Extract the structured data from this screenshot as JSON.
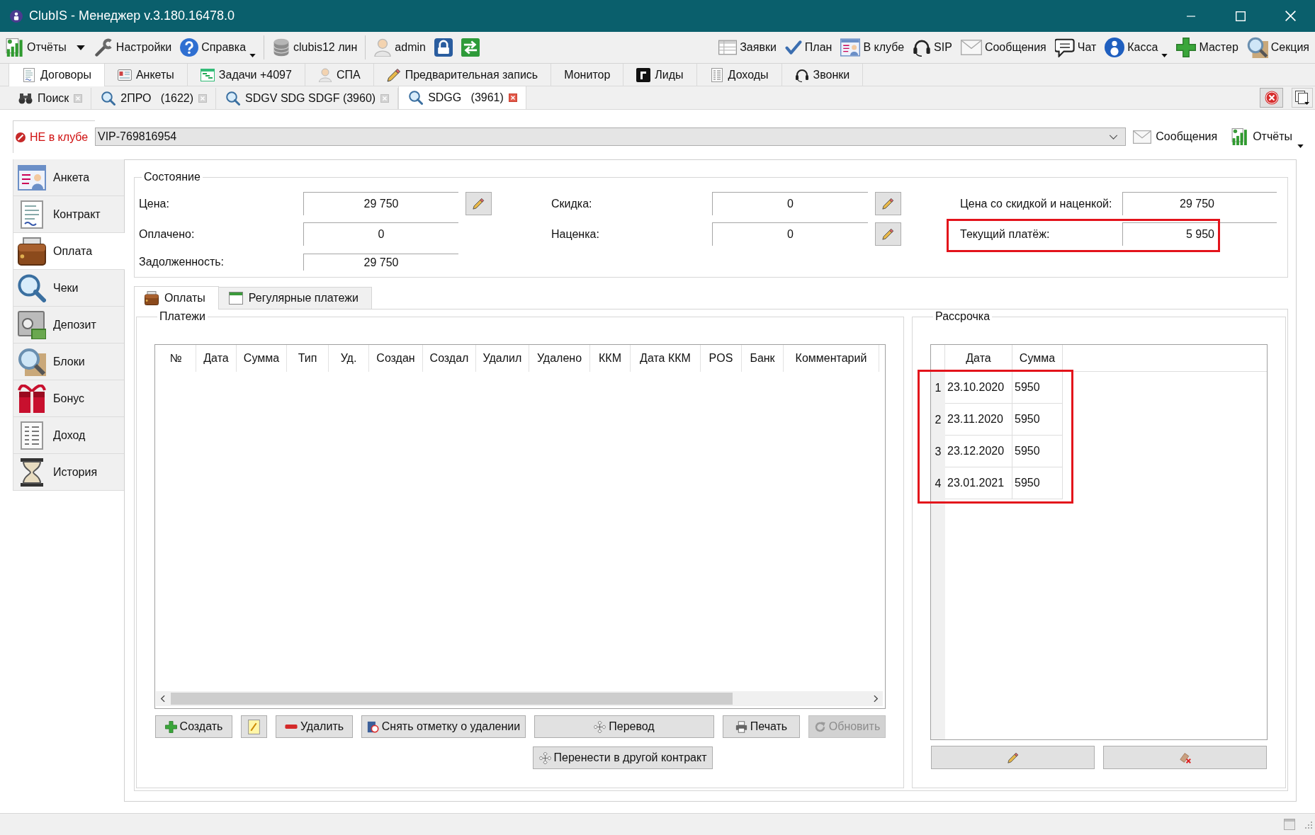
{
  "window": {
    "title": "ClubIS - Менеджер v.3.180.16478.0"
  },
  "toolbar": {
    "left_groups": [
      {
        "items": [
          {
            "kind": "split",
            "label": "Отчёты",
            "dropdown": true
          },
          {
            "kind": "text",
            "label": "Настройки",
            "dropdown": false
          },
          {
            "kind": "text",
            "label": "Справка",
            "dropdown": true
          }
        ]
      },
      {
        "items": [
          {
            "kind": "text",
            "label": "clubis12 лин",
            "dropdown": false
          }
        ]
      },
      {
        "items": [
          {
            "kind": "text",
            "label": "admin",
            "dropdown": false
          },
          {
            "kind": "icon",
            "dropdown": false
          },
          {
            "kind": "icon",
            "dropdown": false
          }
        ]
      }
    ],
    "right_items": [
      {
        "kind": "text",
        "label": "Заявки",
        "dropdown": false
      },
      {
        "kind": "text",
        "label": "План",
        "dropdown": false
      },
      {
        "kind": "text",
        "label": "В клубе",
        "dropdown": false
      },
      {
        "kind": "text",
        "label": "SIP",
        "dropdown": false
      },
      {
        "kind": "text",
        "label": "Сообщения",
        "dropdown": false
      },
      {
        "kind": "text",
        "label": "Чат",
        "dropdown": false
      },
      {
        "kind": "text",
        "label": "Касса",
        "dropdown": true
      },
      {
        "kind": "text",
        "label": "Мастер",
        "dropdown": false
      },
      {
        "kind": "text",
        "label": "Секция",
        "dropdown": false
      }
    ]
  },
  "module_tabs": [
    {
      "label": "Договоры",
      "selected": true
    },
    {
      "label": "Анкеты",
      "selected": false
    },
    {
      "label": "Задачи +4097",
      "selected": false
    },
    {
      "label": "СПА",
      "selected": false
    },
    {
      "label": "Предварительная запись",
      "selected": false
    },
    {
      "label": "Монитор",
      "selected": false
    },
    {
      "label": "Лиды",
      "selected": false
    },
    {
      "label": "Доходы",
      "selected": false
    },
    {
      "label": "Звонки",
      "selected": false
    }
  ],
  "document_tabs": [
    {
      "label": "Поиск",
      "selected": false
    },
    {
      "label": "2ПРО   (1622)",
      "selected": false
    },
    {
      "label": "SDGV SDG SDGF (3960)",
      "selected": false
    },
    {
      "label": "SDGG   (3961)",
      "selected": true
    }
  ],
  "customer": {
    "in_club": false,
    "status": "НЕ в клубе",
    "card": "VIP-769816954",
    "actions": [
      {
        "label": "Сообщения",
        "dropdown": false
      },
      {
        "label": "Отчёты",
        "dropdown": true
      }
    ]
  },
  "sidebar": {
    "items": [
      {
        "label": "Анкета",
        "selected": false
      },
      {
        "label": "Контракт",
        "selected": false
      },
      {
        "label": "Оплата",
        "selected": true
      },
      {
        "label": "Чеки",
        "selected": false
      },
      {
        "label": "Депозит",
        "selected": false
      },
      {
        "label": "Блоки",
        "selected": false
      },
      {
        "label": "Бонус",
        "selected": false
      },
      {
        "label": "Доход",
        "selected": false
      },
      {
        "label": "История",
        "selected": false
      }
    ]
  },
  "state": {
    "title": "Состояние",
    "columns": [
      {
        "fields": [
          {
            "label": "Цена:",
            "value": "29 750",
            "editable": true,
            "highlighted": false
          },
          {
            "label": "Оплачено:",
            "value": "0",
            "editable": false,
            "highlighted": false
          },
          {
            "label": "Задолженность:",
            "value": "29 750",
            "editable": false,
            "highlighted": false
          }
        ]
      },
      {
        "fields": [
          {
            "label": "Скидка:",
            "value": "0",
            "editable": true,
            "highlighted": false
          },
          {
            "label": "Наценка:",
            "value": "0",
            "editable": true,
            "highlighted": false
          }
        ]
      },
      {
        "fields": [
          {
            "label": "Цена со скидкой и наценкой:",
            "value": "29 750",
            "editable": false,
            "highlighted": false
          },
          {
            "label": "Текущий платёж:",
            "value": "5 950",
            "editable": false,
            "highlighted": true
          }
        ]
      }
    ]
  },
  "detail_tabs": [
    {
      "label": "Оплаты",
      "selected": true
    },
    {
      "label": "Регулярные платежи",
      "selected": false
    }
  ],
  "payments": {
    "title": "Платежи",
    "columns": [
      "№",
      "Дата",
      "Сумма",
      "Тип",
      "Уд.",
      "Создан",
      "Создал",
      "Удалил",
      "Удалено",
      "ККМ",
      "Дата ККМ",
      "POS",
      "Банк",
      "Комментарий"
    ],
    "button_rows": [
      {
        "buttons": [
          {
            "label": "Создать",
            "disabled": false
          },
          {
            "disabled": false
          },
          {
            "label": "Удалить",
            "disabled": false
          },
          {
            "label": "Снять отметку о удалении",
            "disabled": false
          },
          {
            "label": "Перевод",
            "disabled": false
          },
          {
            "label": "Печать",
            "disabled": false
          },
          {
            "label": "Обновить",
            "disabled": true
          }
        ]
      },
      {
        "buttons": [
          {
            "label": "Перенести в другой контракт",
            "disabled": false
          }
        ]
      }
    ]
  },
  "installments": {
    "title": "Рассрочка",
    "columns": [
      "Дата",
      "Сумма"
    ],
    "highlighted": true,
    "rows": [
      {
        "number": "1",
        "date": "23.10.2020",
        "amount": "5950"
      },
      {
        "number": "2",
        "date": "23.11.2020",
        "amount": "5950"
      },
      {
        "number": "3",
        "date": "23.12.2020",
        "amount": "5950"
      },
      {
        "number": "4",
        "date": "23.01.2021",
        "amount": "5950"
      }
    ],
    "buttons": [
      {
        "disabled": false
      },
      {
        "disabled": false
      }
    ]
  }
}
